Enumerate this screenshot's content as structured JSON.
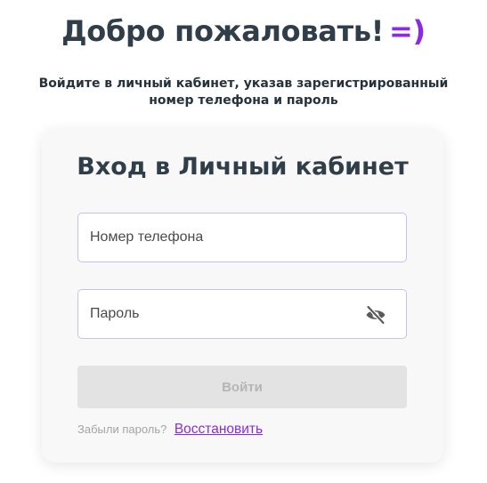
{
  "header": {
    "welcome_text": "Добро пожаловать!",
    "smile": "=)",
    "subtitle": "Войдите в личный кабинет, указав зарегистрированный номер телефона и пароль"
  },
  "login_card": {
    "title": "Вход в Личный кабинет",
    "phone_placeholder": "Номер телефона",
    "phone_value": "",
    "password_placeholder": "Пароль",
    "password_value": "",
    "password_toggle_icon": "eye-slash-icon",
    "submit_label": "Войти",
    "forgot_text": "Забыли пароль?",
    "restore_link": "Восстановить"
  },
  "colors": {
    "accent": "#8a2be2",
    "heading": "#2f3e48",
    "field_border": "#c9c0e6",
    "button_disabled_bg": "#e3e3e3",
    "button_disabled_text": "#b5b5b5"
  }
}
